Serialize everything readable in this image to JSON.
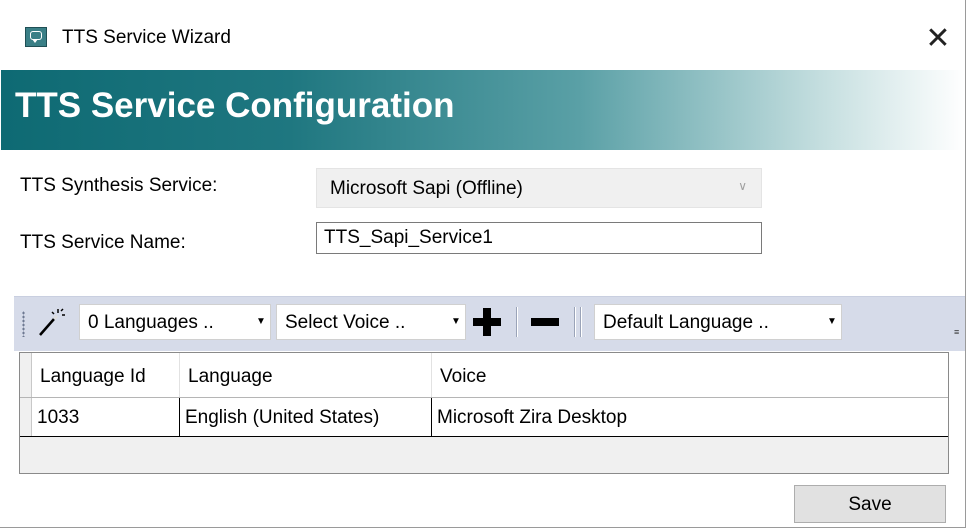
{
  "window": {
    "title": "TTS Service Wizard",
    "close_label": "✕"
  },
  "banner": {
    "title": "TTS Service Configuration"
  },
  "form": {
    "synthesis_label": "TTS Synthesis Service:",
    "synthesis_value": "Microsoft Sapi (Offline)",
    "name_label": "TTS Service Name:",
    "name_value": "TTS_Sapi_Service1"
  },
  "toolbar": {
    "languages_combo": "0 Languages ..",
    "voice_combo": "Select Voice ..",
    "default_language_combo": "Default Language .."
  },
  "grid": {
    "columns": [
      "Language Id",
      "Language",
      "Voice"
    ],
    "rows": [
      [
        "1033",
        "English (United States)",
        "Microsoft Zira Desktop"
      ]
    ]
  },
  "footer": {
    "save_label": "Save"
  },
  "colors": {
    "banner_start": "#0e6a73",
    "toolbar_bg": "#d6dbe9"
  }
}
